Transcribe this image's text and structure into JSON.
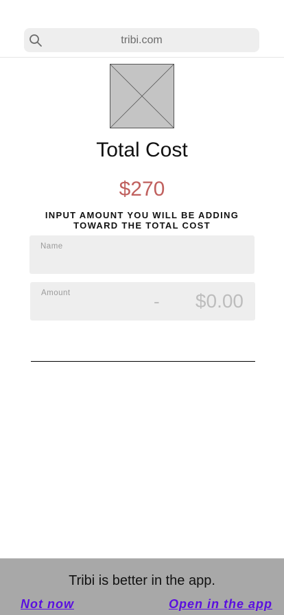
{
  "browser": {
    "url": "tribi.com",
    "search_icon": "search-icon"
  },
  "hero": {
    "image_icon": "image-placeholder-icon"
  },
  "title": "Total Cost",
  "total_amount": "$270",
  "instruction": "INPUT AMOUNT YOU WILL BE ADDING TOWARD THE TOTAL COST",
  "form": {
    "name_label": "Name",
    "name_value": "",
    "amount_label": "Amount",
    "amount_dash": "-",
    "amount_value": "$0.00"
  },
  "app_banner": {
    "message": "Tribi is better in the app.",
    "not_now": "Not now",
    "open_app": "Open in the app"
  },
  "colors": {
    "total_amount": "#c0605e",
    "link": "#5a0fe0",
    "banner_background": "#a8a8a8",
    "field_background": "#eeeeee"
  }
}
